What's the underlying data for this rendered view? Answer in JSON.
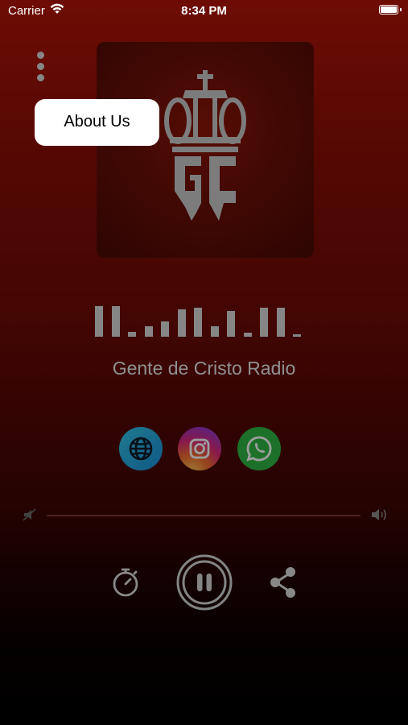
{
  "status_bar": {
    "carrier": "Carrier",
    "time": "8:34 PM",
    "icons": [
      "wifi-icon",
      "battery-icon"
    ]
  },
  "menu": {
    "icon": "more-vertical-icon",
    "popup_item": "About Us"
  },
  "artwork": {
    "logo": "GC crown logo",
    "logo_letters": "GC"
  },
  "player": {
    "station_name": "Gente de Cristo Radio",
    "equalizer_levels": [
      1.0,
      1.0,
      0.15,
      0.35,
      0.5,
      0.9,
      0.95,
      0.35,
      0.85,
      0.12,
      0.95,
      0.95,
      0.08
    ],
    "volume_level": 0.0,
    "state": "playing"
  },
  "social_links": [
    {
      "name": "website",
      "icon": "globe-icon",
      "color": "#2aa8e0"
    },
    {
      "name": "instagram",
      "icon": "instagram-icon",
      "color": "#dc2a79"
    },
    {
      "name": "whatsapp",
      "icon": "whatsapp-icon",
      "color": "#2fb543"
    }
  ],
  "controls": {
    "left": "timer-icon",
    "center": "pause-icon",
    "right": "share-icon"
  },
  "colors": {
    "background_top": "#b11407",
    "background_bottom": "#000000",
    "popup_background": "#ffffff"
  }
}
